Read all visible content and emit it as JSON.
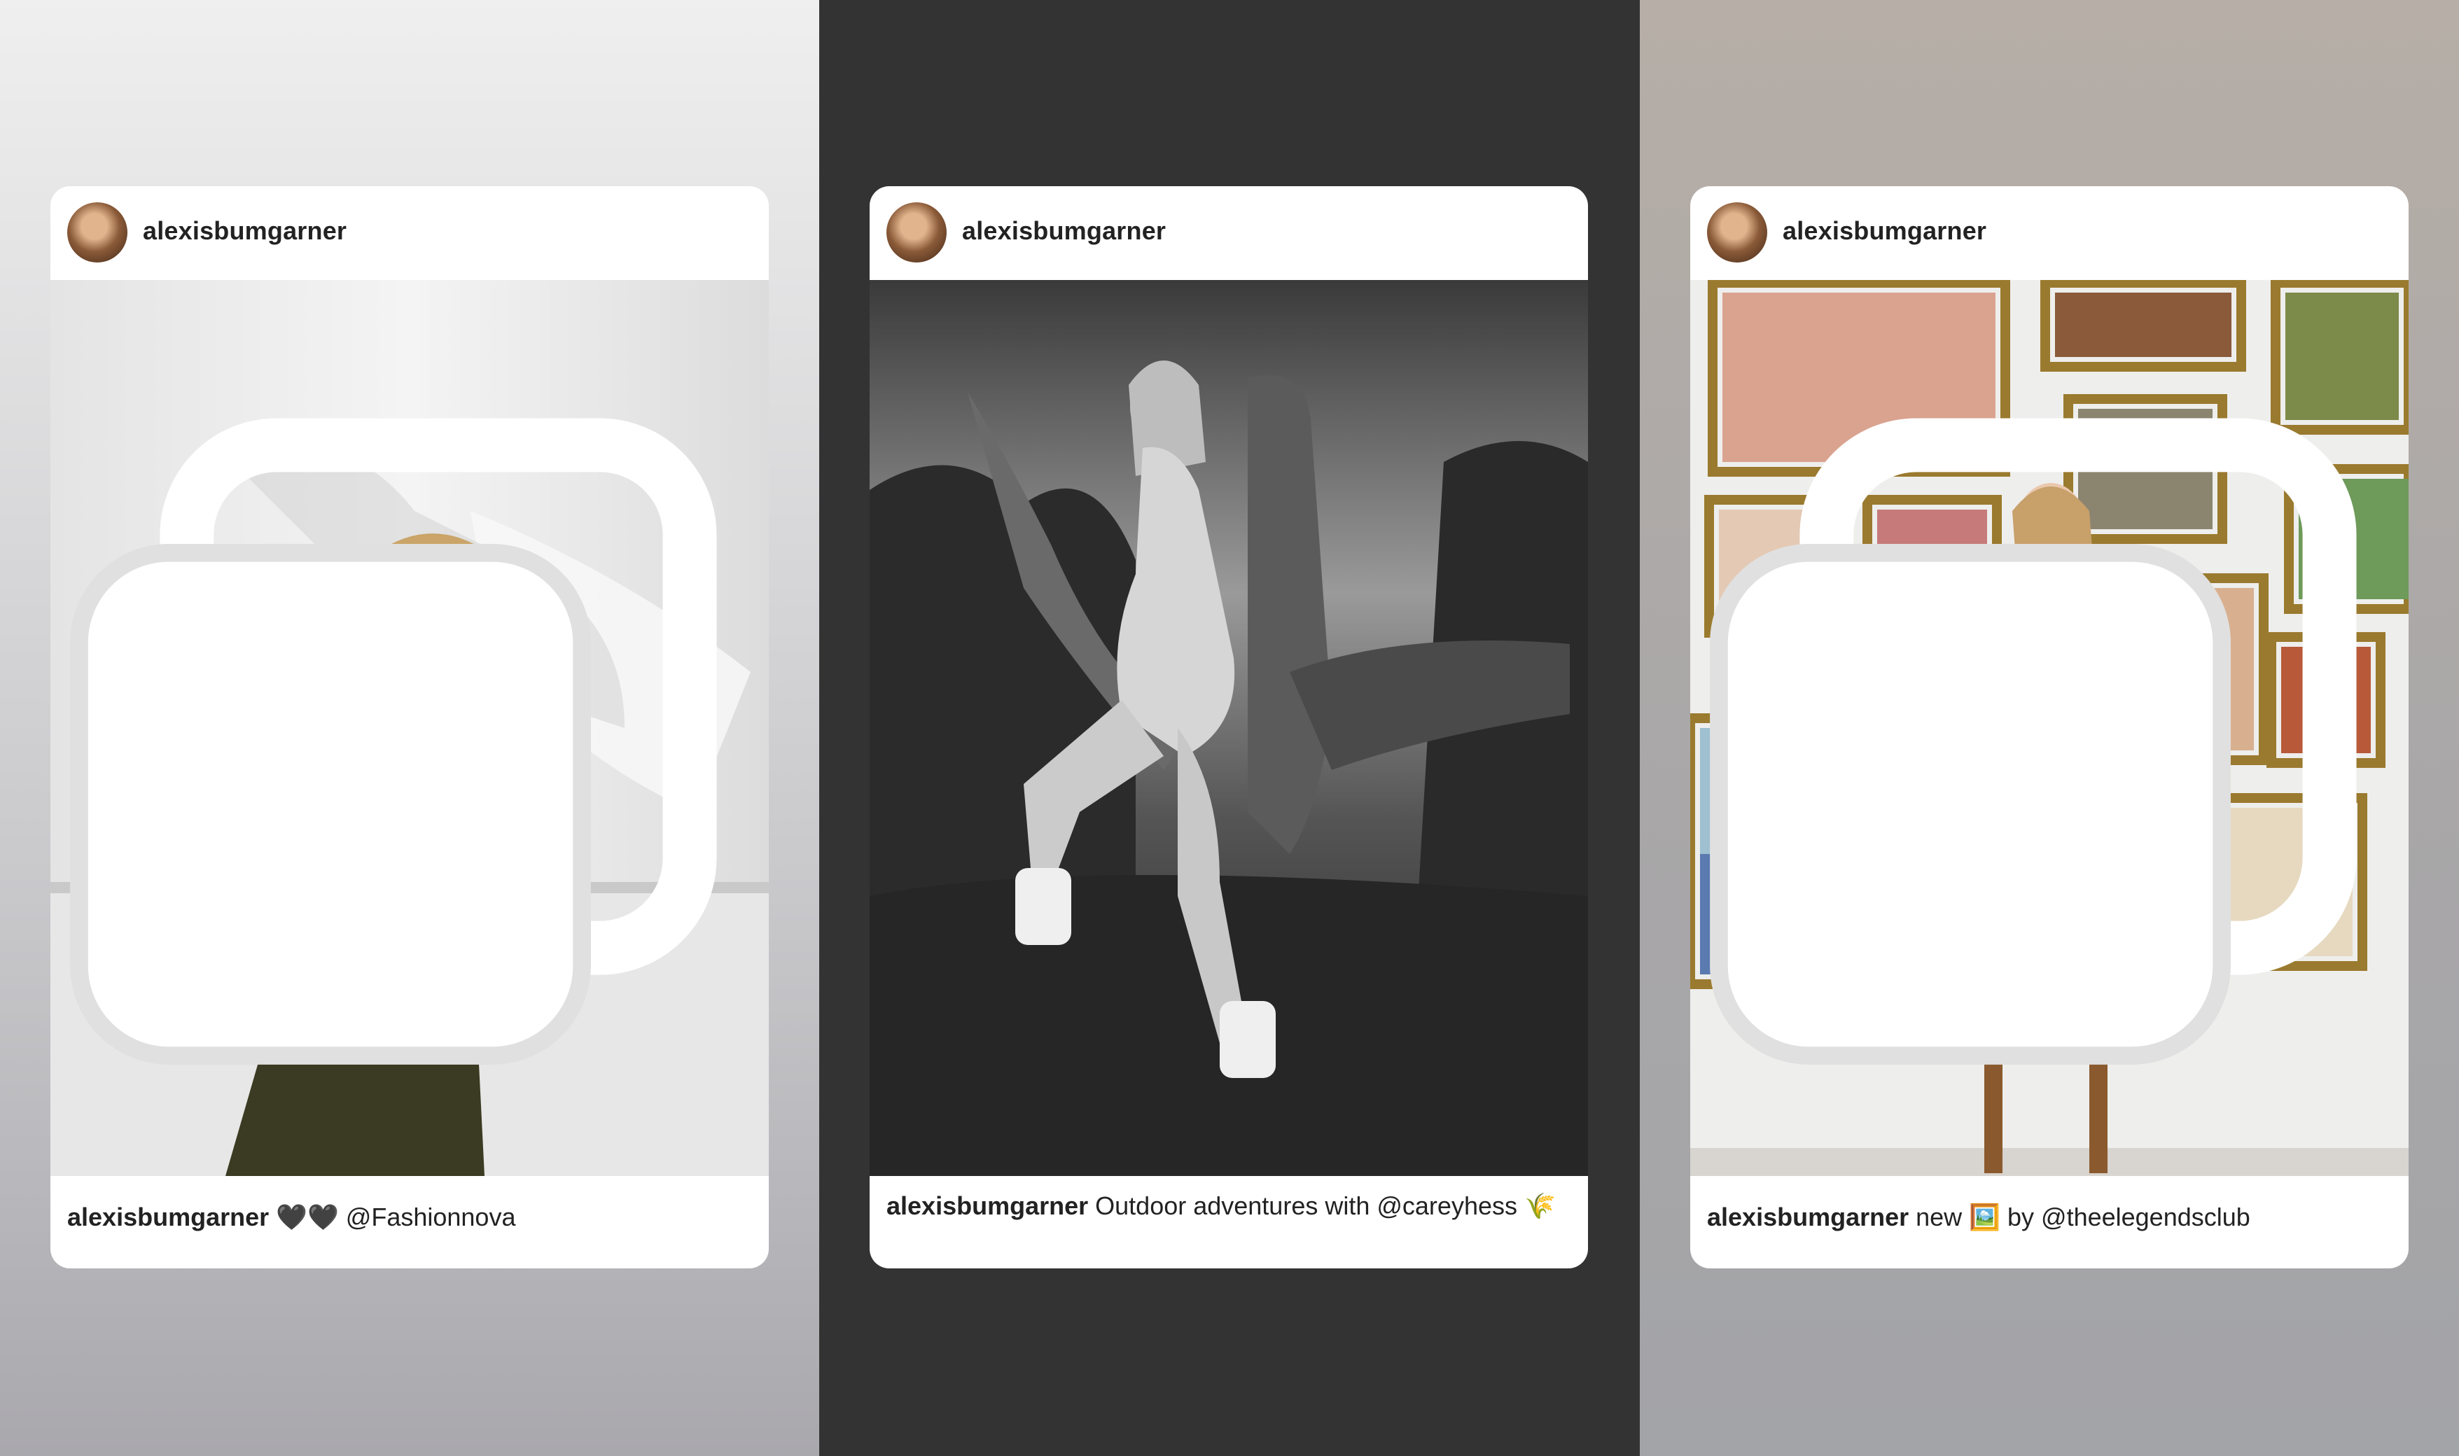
{
  "posts": [
    {
      "username": "alexisbumgarner",
      "caption_user": "alexisbumgarner",
      "caption_text": "🖤🖤 @Fashionnova",
      "multiple_images": true,
      "background": "light-gray"
    },
    {
      "username": "alexisbumgarner",
      "caption_user": "alexisbumgarner",
      "caption_text": "Outdoor adventures with @careyhess 🌾",
      "multiple_images": false,
      "background": "dark-gray"
    },
    {
      "username": "alexisbumgarner",
      "caption_user": "alexisbumgarner",
      "caption_text": "new 🖼️ by @theelegendsclub",
      "multiple_images": true,
      "background": "warm-gray"
    }
  ],
  "colors": {
    "panel_1_bg": "#e6e6e8",
    "panel_2_bg": "#333333",
    "panel_3_bg": "#b1aca8",
    "text": "#222222",
    "card_bg": "#ffffff"
  }
}
